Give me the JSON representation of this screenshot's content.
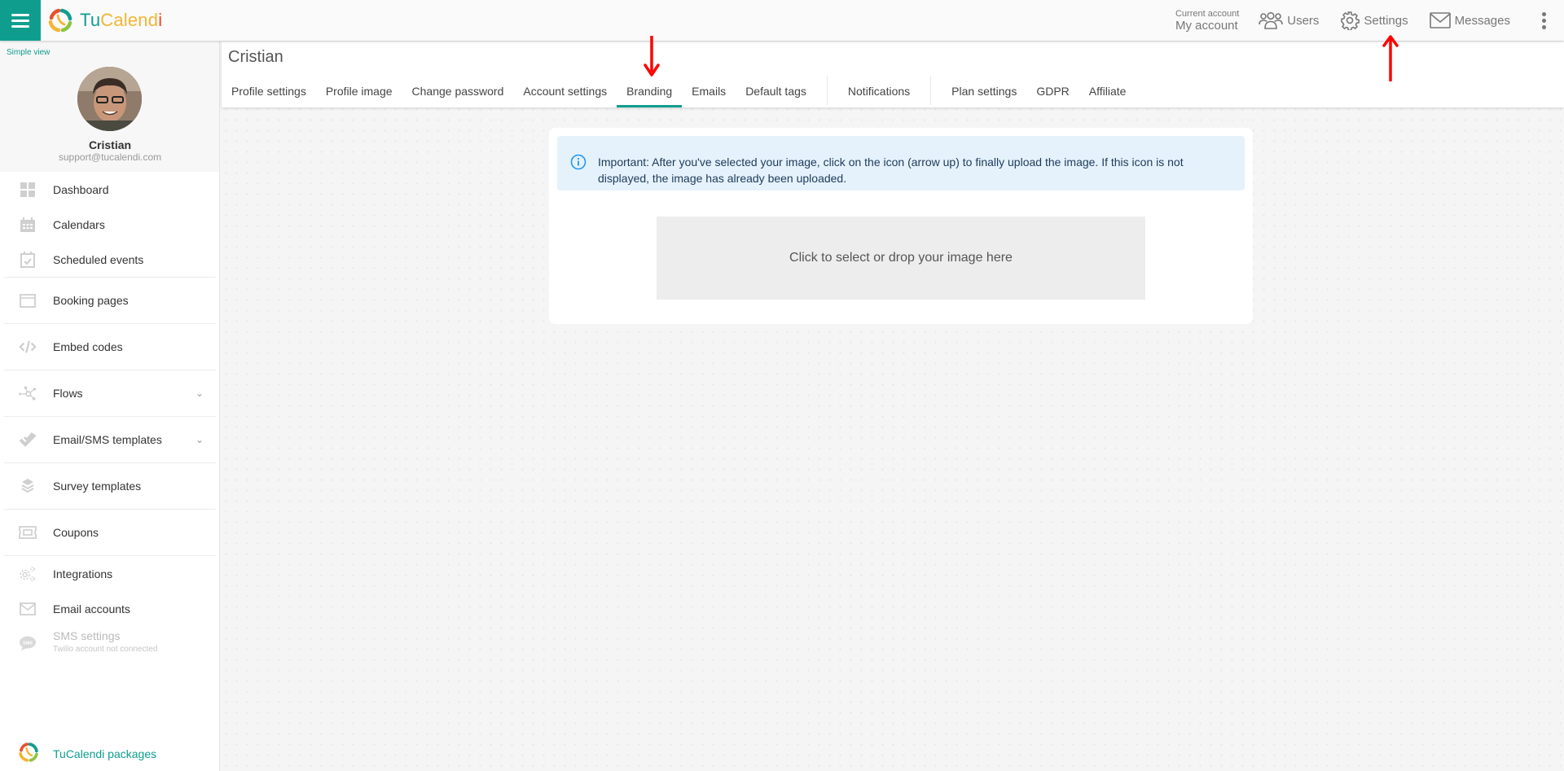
{
  "app": {
    "logo_text_tu": "Tu",
    "logo_text_calend": "Calend",
    "logo_text_i": "i",
    "brand_colors": {
      "teal": "#0f9e8e",
      "yellow": "#f4b533",
      "red": "#e8502d",
      "green": "#8dc63f"
    }
  },
  "topbar": {
    "menu_icon": "hamburger-icon",
    "current_account_label": "Current account",
    "current_account_value": "My account",
    "links": [
      {
        "label": "Users",
        "icon": "users-icon"
      },
      {
        "label": "Settings",
        "icon": "gear-icon"
      },
      {
        "label": "Messages",
        "icon": "envelope-icon"
      }
    ],
    "more_icon": "kebab-icon"
  },
  "sidebar": {
    "simple_view": "Simple view",
    "profile": {
      "name": "Cristian",
      "email": "support@tucalendi.com"
    },
    "items": [
      {
        "label": "Dashboard",
        "icon": "dashboard-icon"
      },
      {
        "label": "Calendars",
        "icon": "calendar-icon"
      },
      {
        "label": "Scheduled events",
        "icon": "calendar-check-icon"
      },
      {
        "label": "Booking pages",
        "icon": "browser-window-icon"
      },
      {
        "label": "Embed codes",
        "icon": "code-icon"
      },
      {
        "label": "Flows",
        "icon": "flows-icon",
        "expandable": true
      },
      {
        "label": "Email/SMS templates",
        "icon": "double-check-icon",
        "expandable": true
      },
      {
        "label": "Survey templates",
        "icon": "layers-icon"
      },
      {
        "label": "Coupons",
        "icon": "ticket-icon"
      },
      {
        "label": "Integrations",
        "icon": "gears-icon"
      },
      {
        "label": "Email accounts",
        "icon": "envelope-icon"
      },
      {
        "label": "SMS settings",
        "sublabel": "Twilio account not connected",
        "icon": "sms-bubble-icon",
        "disabled": true
      }
    ],
    "chevron": "⌄",
    "packages_label": "TuCalendi packages"
  },
  "main": {
    "title": "Cristian",
    "tabs": [
      {
        "label": "Profile settings"
      },
      {
        "label": "Profile image"
      },
      {
        "label": "Change password"
      },
      {
        "label": "Account settings"
      },
      {
        "label": "Branding",
        "active": true
      },
      {
        "label": "Emails"
      },
      {
        "label": "Default tags"
      },
      {
        "label": "Notifications"
      },
      {
        "label": "Plan settings"
      },
      {
        "label": "GDPR"
      },
      {
        "label": "Affiliate"
      }
    ],
    "alert": "Important: After you've selected your image, click on the icon (arrow up) to finally upload the image. If this icon is not displayed, the image has already been uploaded.",
    "dropzone_label": "Click to select or drop your image here"
  },
  "annotations": {
    "arrow_color": "#ff0000"
  }
}
